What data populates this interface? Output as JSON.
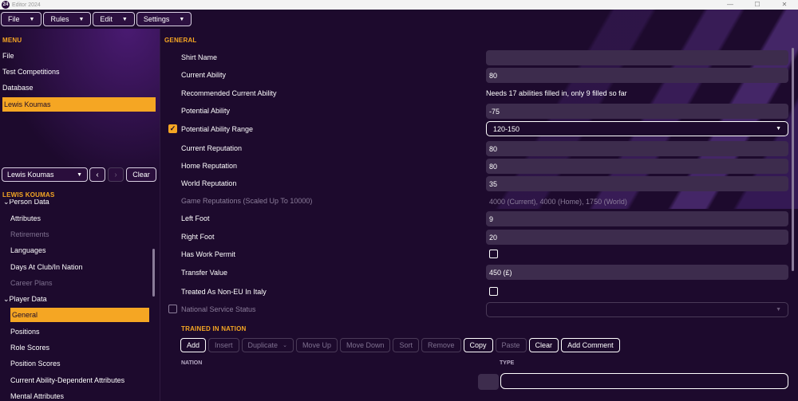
{
  "window": {
    "logo": "24",
    "title": "Editor 2024",
    "controls": [
      "—",
      "☐",
      "✕"
    ]
  },
  "menubar": [
    {
      "label": "File"
    },
    {
      "label": "Rules"
    },
    {
      "label": "Edit"
    },
    {
      "label": "Settings"
    }
  ],
  "left": {
    "menu_title": "MENU",
    "menu_items": [
      "File",
      "Test Competitions",
      "Database",
      "Lewis Koumas"
    ],
    "person_select": "Lewis Koumas",
    "prev_glyph": "‹",
    "next_glyph": "›",
    "clear_label": "Clear",
    "person_title": "LEWIS KOUMAS",
    "tree": [
      "Person Data",
      "Attributes",
      "Retirements",
      "Languages",
      "Days At Club/In Nation",
      "Career Plans",
      "Player Data",
      "General",
      "Positions",
      "Role Scores",
      "Position Scores",
      "Current Ability-Dependent Attributes",
      "Mental Attributes"
    ]
  },
  "main": {
    "section_title": "GENERAL",
    "fields": {
      "shirt_name": {
        "label": "Shirt Name",
        "value": ""
      },
      "current_ability": {
        "label": "Current Ability",
        "value": "80"
      },
      "recommended_ca": {
        "label": "Recommended Current Ability",
        "value": "Needs 17 abilities filled in, only 9 filled so far"
      },
      "potential_ability": {
        "label": "Potential Ability",
        "value": "-75"
      },
      "pa_range": {
        "label": "Potential Ability Range",
        "value": "120-150",
        "checked": "✓"
      },
      "current_reputation": {
        "label": "Current Reputation",
        "value": "80"
      },
      "home_reputation": {
        "label": "Home Reputation",
        "value": "80"
      },
      "world_reputation": {
        "label": "World Reputation",
        "value": "35"
      },
      "game_reputations": {
        "label": "Game Reputations (Scaled Up To 10000)",
        "value": "4000 (Current), 4000 (Home), 1750 (World)"
      },
      "left_foot": {
        "label": "Left Foot",
        "value": "9"
      },
      "right_foot": {
        "label": "Right Foot",
        "value": "20"
      },
      "work_permit": {
        "label": "Has Work Permit"
      },
      "transfer_value": {
        "label": "Transfer Value",
        "value": "450 (£)"
      },
      "non_eu_italy": {
        "label": "Treated As Non-EU In Italy"
      },
      "national_service": {
        "label": "National Service Status",
        "value": ""
      }
    },
    "trained_title": "TRAINED IN NATION",
    "toolbar": [
      "Add",
      "Insert",
      "Duplicate",
      "Move Up",
      "Move Down",
      "Sort",
      "Remove",
      "Copy",
      "Paste",
      "Clear",
      "Add Comment"
    ],
    "columns": {
      "nation": "NATION",
      "type": "TYPE"
    }
  },
  "colors": {
    "accent": "#f5a623",
    "background": "#1d0a2d",
    "input": "#3d2c4d"
  }
}
